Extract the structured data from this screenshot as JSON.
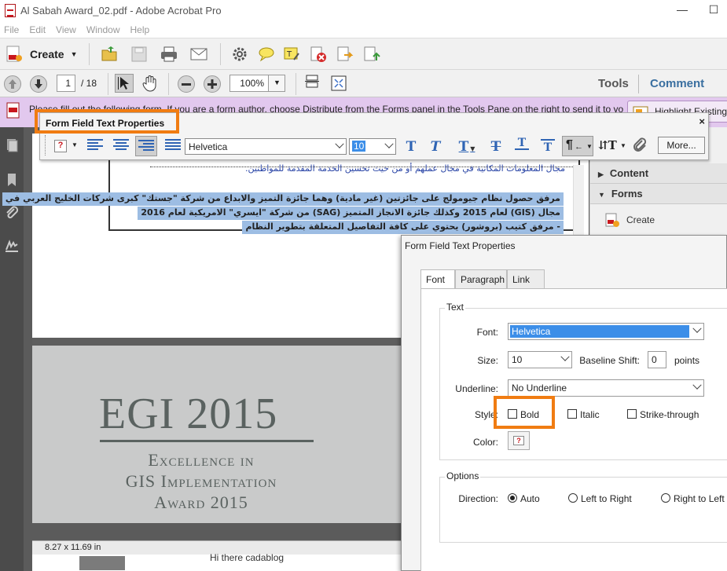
{
  "window": {
    "title": "Al Sabah Award_02.pdf - Adobe Acrobat Pro",
    "minimize_glyph": "—",
    "maximize_glyph": "☐"
  },
  "menu": [
    "File",
    "Edit",
    "View",
    "Window",
    "Help"
  ],
  "toolbar": {
    "create_label": "Create"
  },
  "nav": {
    "page_current": "1",
    "page_total": "/ 18",
    "zoom": "100%",
    "tools_tab": "Tools",
    "comment_tab": "Comment"
  },
  "notice": {
    "text": "Please fill out the following form. If you are a form author, choose Distribute from the Forms panel in the Tools Pane on the right to send it to yo",
    "highlight_button": "Highlight Existing"
  },
  "document": {
    "arabic_top": "مجال المعلومات المكانية في مجال عملهم أو من حيث تحسين الخدمة المقدمة للمواطنين.",
    "highlight_lines": [
      "مرفق حصول نظام جيومولج على جائزتين (غير مادية) وهما جائزة التميز والابداع من شركة \"جستك\" كبرى شركات الخليج العربي في",
      "مجال (GIS) لعام 2015 وكذلك جائزة الانجاز المتميز (SAG) من شركة \"ايسري\" الامريكية لعام 2016",
      "- مرفق كتيب (بروشور) يحتوي على كافة التفاصيل المتعلقة بتطوير النظام"
    ],
    "egi_title": "EGI 2015",
    "egi_line1": "Excellence in",
    "egi_line2": "GIS Implementation",
    "egi_line3": "Award 2015",
    "page_size": "8.27 x 11.69 in",
    "bottom_caption": "Hi there cadablog"
  },
  "right_panel": {
    "content_label": "Content",
    "forms_label": "Forms",
    "create_label": "Create"
  },
  "format_bar": {
    "title": "Form Field Text Properties",
    "close_glyph": "×",
    "font": "Helvetica",
    "size": "10",
    "more_label": "More..."
  },
  "dialog": {
    "title": "Form Field Text Properties",
    "tabs": [
      "Font",
      "Paragraph",
      "Link"
    ],
    "text_group": "Text",
    "font_label": "Font:",
    "font_value": "Helvetica",
    "size_label": "Size:",
    "size_value": "10",
    "baseline_label": "Baseline Shift:",
    "baseline_value": "0",
    "points_label": "points",
    "underline_label": "Underline:",
    "underline_value": "No Underline",
    "style_label": "Style:",
    "bold_label": "Bold",
    "italic_label": "Italic",
    "strike_label": "Strike-through",
    "color_label": "Color:",
    "options_group": "Options",
    "direction_label": "Direction:",
    "dir_auto": "Auto",
    "dir_ltr": "Left to Right",
    "dir_rtl": "Right to Left"
  },
  "colors": {
    "highlight_orange": "#f07c12",
    "notice_purple": "#e2c8ee",
    "accent_blue": "#2f64b4",
    "selection_blue": "#3c8ee8"
  }
}
